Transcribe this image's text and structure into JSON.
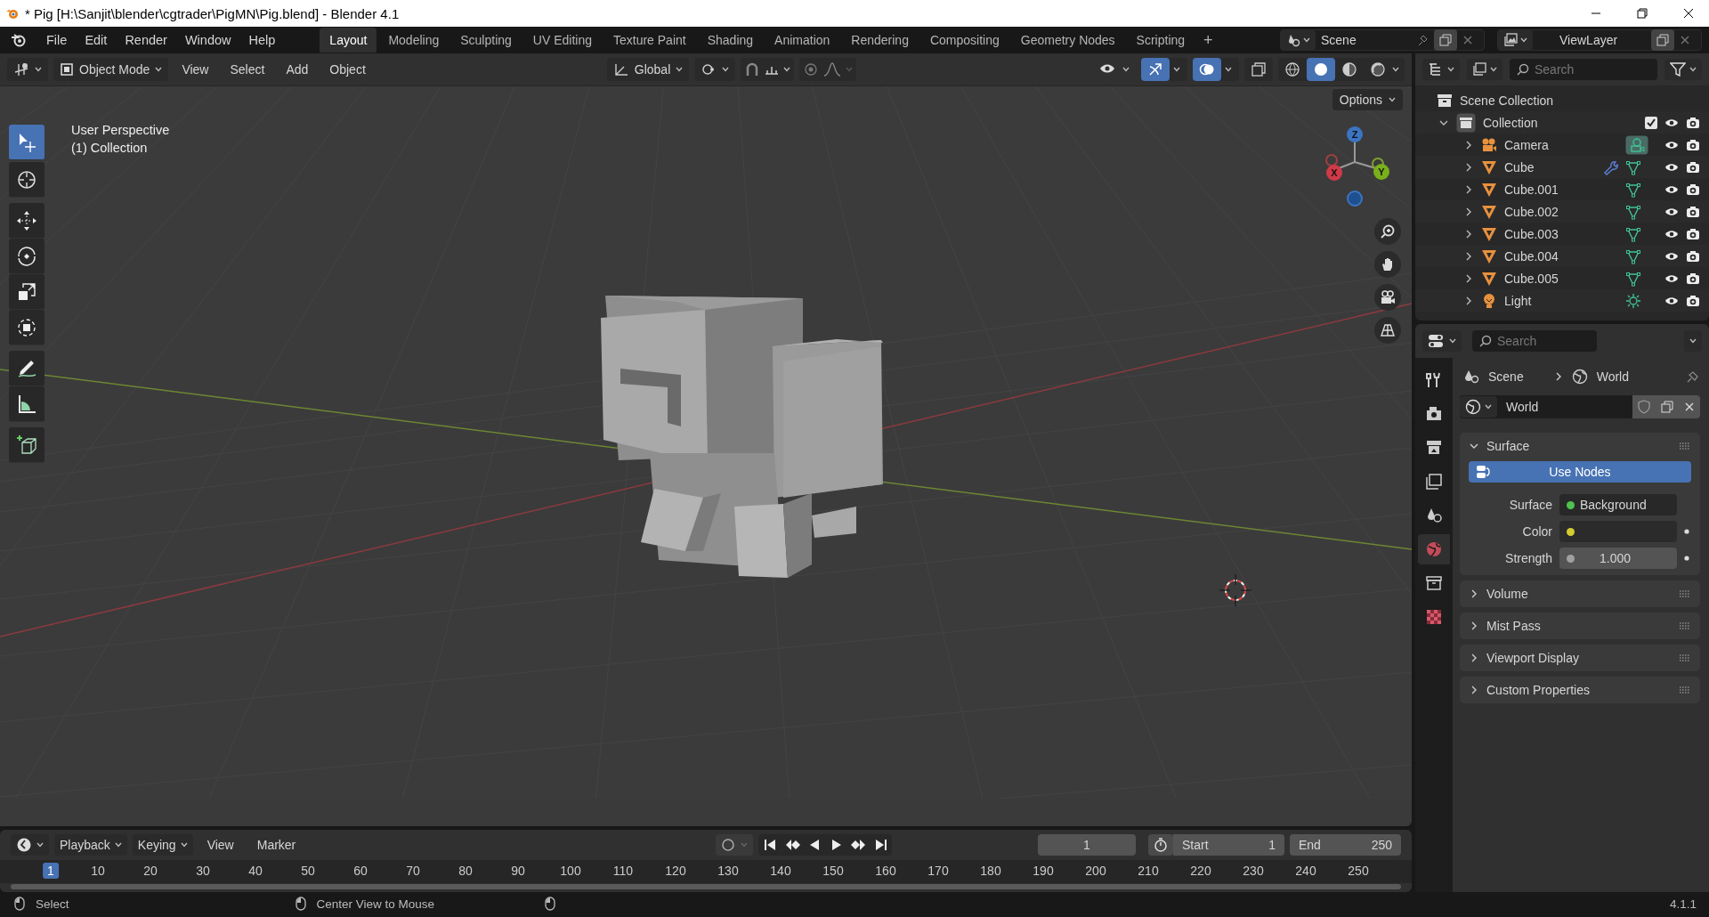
{
  "window": {
    "title": "* Pig [H:\\Sanjit\\blender\\cgtrader\\PigMN\\Pig.blend] - Blender 4.1"
  },
  "menu": [
    "File",
    "Edit",
    "Render",
    "Window",
    "Help"
  ],
  "workspaces": [
    {
      "label": "Layout",
      "selected": true
    },
    {
      "label": "Modeling",
      "selected": false
    },
    {
      "label": "Sculpting",
      "selected": false
    },
    {
      "label": "UV Editing",
      "selected": false
    },
    {
      "label": "Texture Paint",
      "selected": false
    },
    {
      "label": "Shading",
      "selected": false
    },
    {
      "label": "Animation",
      "selected": false
    },
    {
      "label": "Rendering",
      "selected": false
    },
    {
      "label": "Compositing",
      "selected": false
    },
    {
      "label": "Geometry Nodes",
      "selected": false
    },
    {
      "label": "Scripting",
      "selected": false
    }
  ],
  "add_workspace": "+",
  "scene": "Scene",
  "view_layer": "ViewLayer",
  "viewport_header": {
    "mode": "Object Mode",
    "menus": [
      "View",
      "Select",
      "Add",
      "Object"
    ],
    "orientation": "Global",
    "options": "Options"
  },
  "viewport": {
    "info": [
      "User Perspective",
      "(1) Collection"
    ],
    "gizmo_axes": [
      "X",
      "Y",
      "Z"
    ]
  },
  "outliner": {
    "search_placeholder": "Search",
    "root": "Scene Collection",
    "collection": {
      "name": "Collection",
      "expanded": true,
      "checked": true,
      "children": [
        {
          "name": "Camera",
          "kind": "camera"
        },
        {
          "name": "Cube",
          "kind": "mesh",
          "modifier": true
        },
        {
          "name": "Cube.001",
          "kind": "mesh",
          "modifier": false
        },
        {
          "name": "Cube.002",
          "kind": "mesh",
          "modifier": false
        },
        {
          "name": "Cube.003",
          "kind": "mesh",
          "modifier": false
        },
        {
          "name": "Cube.004",
          "kind": "mesh",
          "modifier": false
        },
        {
          "name": "Cube.005",
          "kind": "mesh",
          "modifier": false
        },
        {
          "name": "Light",
          "kind": "light"
        }
      ]
    }
  },
  "properties": {
    "search_placeholder": "Search",
    "breadcrumb": [
      "Scene",
      "World"
    ],
    "world_name": "World",
    "use_nodes": "Use Nodes",
    "panels": [
      {
        "title": "Surface",
        "expanded": true
      },
      {
        "title": "Volume",
        "expanded": false
      },
      {
        "title": "Mist Pass",
        "expanded": false
      },
      {
        "title": "Viewport Display",
        "expanded": false
      },
      {
        "title": "Custom Properties",
        "expanded": false
      }
    ],
    "fields": [
      {
        "kind": "socket",
        "label": "Surface",
        "value": "Background",
        "color": "#4fc04f"
      },
      {
        "kind": "color",
        "label": "Color",
        "color": "#d4cc30"
      },
      {
        "kind": "number",
        "label": "Strength",
        "value": "1.000",
        "color": "#a0a0a0"
      }
    ]
  },
  "timeline": {
    "menus": [
      "Playback",
      "Keying",
      "View",
      "Marker"
    ],
    "current_frame": "1",
    "start_label": "Start",
    "start": "1",
    "end_label": "End",
    "end": "250",
    "ruler": [
      {
        "label": "1",
        "selected": true
      },
      {
        "label": "10",
        "selected": false
      },
      {
        "label": "20",
        "selected": false
      },
      {
        "label": "30",
        "selected": false
      },
      {
        "label": "40",
        "selected": false
      },
      {
        "label": "50",
        "selected": false
      },
      {
        "label": "60",
        "selected": false
      },
      {
        "label": "70",
        "selected": false
      },
      {
        "label": "80",
        "selected": false
      },
      {
        "label": "90",
        "selected": false
      },
      {
        "label": "100",
        "selected": false
      },
      {
        "label": "110",
        "selected": false
      },
      {
        "label": "120",
        "selected": false
      },
      {
        "label": "130",
        "selected": false
      },
      {
        "label": "140",
        "selected": false
      },
      {
        "label": "150",
        "selected": false
      },
      {
        "label": "160",
        "selected": false
      },
      {
        "label": "170",
        "selected": false
      },
      {
        "label": "180",
        "selected": false
      },
      {
        "label": "190",
        "selected": false
      },
      {
        "label": "200",
        "selected": false
      },
      {
        "label": "210",
        "selected": false
      },
      {
        "label": "220",
        "selected": false
      },
      {
        "label": "230",
        "selected": false
      },
      {
        "label": "240",
        "selected": false
      },
      {
        "label": "250",
        "selected": false
      }
    ]
  },
  "status_bar": {
    "hints": [
      "Select",
      "Center View to Mouse"
    ],
    "version": "4.1.1"
  }
}
